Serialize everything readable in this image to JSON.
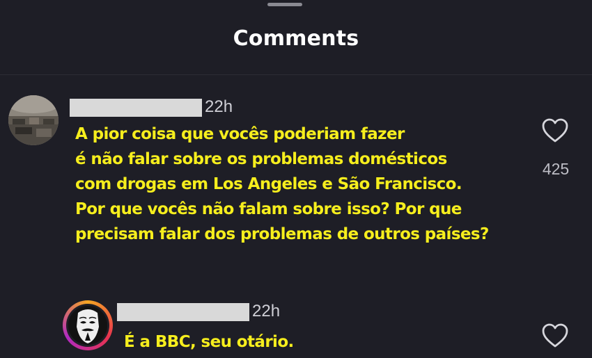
{
  "sheet": {
    "title": "Comments"
  },
  "comments": [
    {
      "username": "",
      "time": "22h",
      "lines": [
        "A pior coisa que vocês poderiam fazer",
        "é não falar sobre os problemas domésticos",
        "com drogas em Los Angeles e São Francisco.",
        "Por que vocês não falam sobre isso? Por que",
        "precisam falar dos problemas de outros países?"
      ],
      "like_count": "425",
      "like_icon": "heart-outline-icon"
    },
    {
      "username": "",
      "time": "22h",
      "lines": [
        "É a BBC, seu otário."
      ],
      "like_icon": "heart-outline-icon",
      "is_reply": true
    }
  ],
  "colors": {
    "background": "#1e1e26",
    "comment_text": "#f6ee1d",
    "title_text": "#ffffff",
    "meta_text": "#cfcfd6",
    "story_ring": [
      "#f5a623",
      "#e8334f",
      "#b02ac0"
    ]
  }
}
